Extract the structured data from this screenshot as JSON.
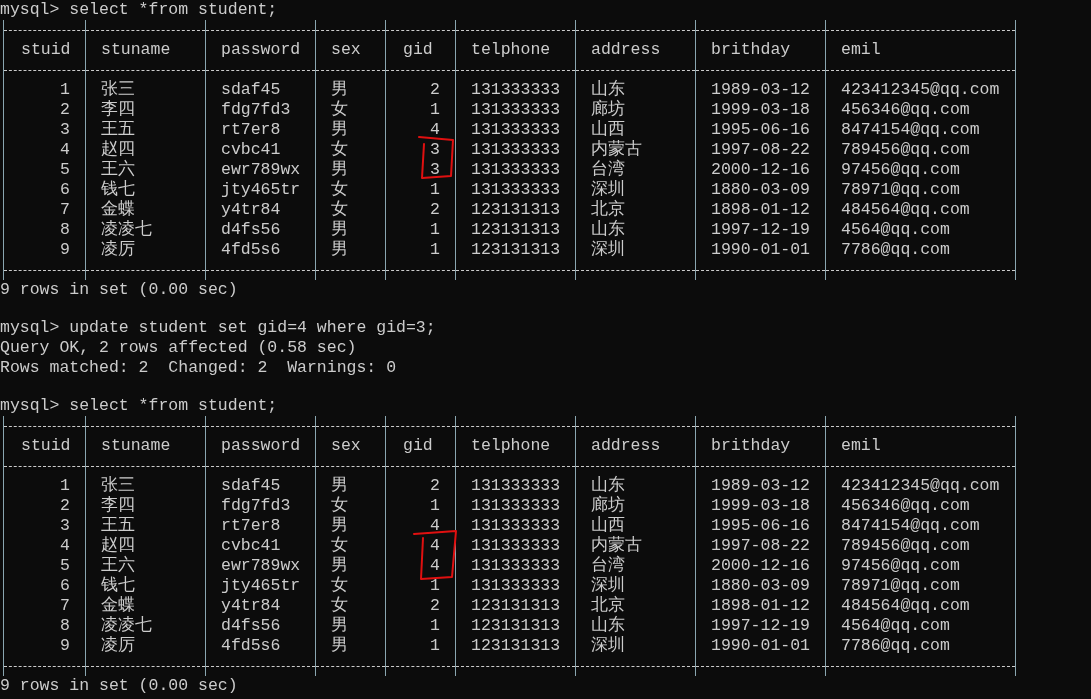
{
  "console": [
    {
      "kind": "line",
      "text": "mysql> select *from student;"
    },
    {
      "kind": "table",
      "columns": [
        {
          "label": "stuid",
          "numeric": true
        },
        {
          "label": "stuname",
          "numeric": false
        },
        {
          "label": "password",
          "numeric": false
        },
        {
          "label": "sex",
          "numeric": false
        },
        {
          "label": "gid",
          "numeric": true
        },
        {
          "label": "telphone",
          "numeric": false
        },
        {
          "label": "address",
          "numeric": false
        },
        {
          "label": "brithday",
          "numeric": false
        },
        {
          "label": "emil",
          "numeric": false
        }
      ],
      "rows": [
        [
          "1",
          "张三",
          "sdaf45",
          "男",
          "2",
          "131333333",
          "山东",
          "1989-03-12",
          "423412345@qq.com"
        ],
        [
          "2",
          "李四",
          "fdg7fd3",
          "女",
          "1",
          "131333333",
          "廊坊",
          "1999-03-18",
          "456346@qq.com"
        ],
        [
          "3",
          "王五",
          "rt7er8",
          "男",
          "4",
          "131333333",
          "山西",
          "1995-06-16",
          "8474154@qq.com"
        ],
        [
          "4",
          "赵四",
          "cvbc41",
          "女",
          "3",
          "131333333",
          "内蒙古",
          "1997-08-22",
          "789456@qq.com"
        ],
        [
          "5",
          "王六",
          "ewr789wx",
          "男",
          "3",
          "131333333",
          "台湾",
          "2000-12-16",
          "97456@qq.com"
        ],
        [
          "6",
          "钱七",
          "jty465tr",
          "女",
          "1",
          "131333333",
          "深圳",
          "1880-03-09",
          "78971@qq.com"
        ],
        [
          "7",
          "金蝶",
          "y4tr84",
          "女",
          "2",
          "123131313",
          "北京",
          "1898-01-12",
          "484564@qq.com"
        ],
        [
          "8",
          "凌凌七",
          "d4fs56",
          "男",
          "1",
          "123131313",
          "山东",
          "1997-12-19",
          "4564@qq.com"
        ],
        [
          "9",
          "凌厉",
          "4fd5s6",
          "男",
          "1",
          "123131313",
          "深圳",
          "1990-01-01",
          "7786@qq.com"
        ]
      ]
    },
    {
      "kind": "line",
      "text": "9 rows in set (0.00 sec)"
    },
    {
      "kind": "blank"
    },
    {
      "kind": "line",
      "text": "mysql> update student set gid=4 where gid=3;"
    },
    {
      "kind": "line",
      "text": "Query OK, 2 rows affected (0.58 sec)"
    },
    {
      "kind": "line",
      "text": "Rows matched: 2  Changed: 2  Warnings: 0"
    },
    {
      "kind": "blank"
    },
    {
      "kind": "line",
      "text": "mysql> select *from student;"
    },
    {
      "kind": "table",
      "columns": [
        {
          "label": "stuid",
          "numeric": true
        },
        {
          "label": "stuname",
          "numeric": false
        },
        {
          "label": "password",
          "numeric": false
        },
        {
          "label": "sex",
          "numeric": false
        },
        {
          "label": "gid",
          "numeric": true
        },
        {
          "label": "telphone",
          "numeric": false
        },
        {
          "label": "address",
          "numeric": false
        },
        {
          "label": "brithday",
          "numeric": false
        },
        {
          "label": "emil",
          "numeric": false
        }
      ],
      "rows": [
        [
          "1",
          "张三",
          "sdaf45",
          "男",
          "2",
          "131333333",
          "山东",
          "1989-03-12",
          "423412345@qq.com"
        ],
        [
          "2",
          "李四",
          "fdg7fd3",
          "女",
          "1",
          "131333333",
          "廊坊",
          "1999-03-18",
          "456346@qq.com"
        ],
        [
          "3",
          "王五",
          "rt7er8",
          "男",
          "4",
          "131333333",
          "山西",
          "1995-06-16",
          "8474154@qq.com"
        ],
        [
          "4",
          "赵四",
          "cvbc41",
          "女",
          "4",
          "131333333",
          "内蒙古",
          "1997-08-22",
          "789456@qq.com"
        ],
        [
          "5",
          "王六",
          "ewr789wx",
          "男",
          "4",
          "131333333",
          "台湾",
          "2000-12-16",
          "97456@qq.com"
        ],
        [
          "6",
          "钱七",
          "jty465tr",
          "女",
          "1",
          "131333333",
          "深圳",
          "1880-03-09",
          "78971@qq.com"
        ],
        [
          "7",
          "金蝶",
          "y4tr84",
          "女",
          "2",
          "123131313",
          "北京",
          "1898-01-12",
          "484564@qq.com"
        ],
        [
          "8",
          "凌凌七",
          "d4fs56",
          "男",
          "1",
          "123131313",
          "山东",
          "1997-12-19",
          "4564@qq.com"
        ],
        [
          "9",
          "凌厉",
          "4fd5s6",
          "男",
          "1",
          "123131313",
          "深圳",
          "1990-01-01",
          "7786@qq.com"
        ]
      ]
    },
    {
      "kind": "line",
      "text": "9 rows in set (0.00 sec)"
    }
  ]
}
